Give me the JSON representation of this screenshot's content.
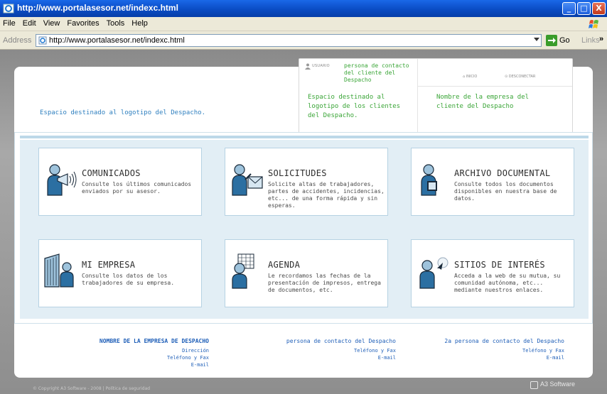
{
  "window": {
    "title": "http://www.portalasesor.net/indexc.html",
    "btn_min": "_",
    "btn_max": "□",
    "btn_close": "X"
  },
  "menu": [
    "File",
    "Edit",
    "View",
    "Favorites",
    "Tools",
    "Help"
  ],
  "address": {
    "label": "Address",
    "url": "http://www.portalasesor.net/indexc.html",
    "go": "Go",
    "links": "Links",
    "chevrons": "»"
  },
  "header": {
    "logo_text": "Espacio destinado al logotipo del Despacho.",
    "usuario_label": "USUARIO",
    "contact_person": "persona de contacto del cliente del Despacho",
    "inicio": "INICIO",
    "desconectar": "DESCONECTAR",
    "client_logo_text": "Espacio destinado al logotipo de los clientes del Despacho.",
    "client_company_text": "Nombre de la empresa del cliente del Despacho"
  },
  "sections": [
    {
      "title": "COMUNICADOS",
      "desc": "Consulte los últimos comunicados enviados por su asesor.",
      "icon": "megaphone-person-icon"
    },
    {
      "title": "SOLICITUDES",
      "desc": "Solicite altas de trabajadores, partes de accidentes, incidencias, etc... de una forma rápida y sin esperas.",
      "icon": "request-person-icon"
    },
    {
      "title": "ARCHIVO DOCUMENTAL",
      "desc": "Consulte todos los documentos disponibles en nuestra base de datos.",
      "icon": "documents-person-icon"
    },
    {
      "title": "MI EMPRESA",
      "desc": "Consulte los datos de los trabajadores de su empresa.",
      "icon": "building-person-icon"
    },
    {
      "title": "AGENDA",
      "desc": "Le recordamos las fechas de la presentación de impresos, entrega de documentos, etc.",
      "icon": "calendar-person-icon"
    },
    {
      "title": "SITIOS DE INTERÉS",
      "desc": "Acceda a la web de su mutua, su comunidad autónoma, etc... mediante nuestros enlaces.",
      "icon": "cursor-person-icon"
    }
  ],
  "footer": {
    "col1": {
      "head": "NOMBRE DE LA EMPRESA DE DESPACHO",
      "l1": "Dirección",
      "l2": "Teléfono y Fax",
      "l3": "E-mail"
    },
    "col2": {
      "head": "persona de contacto del Despacho",
      "l1": "Teléfono y Fax",
      "l2": "E-mail"
    },
    "col3": {
      "head": "2a persona de contacto del Despacho",
      "l1": "Teléfono y Fax",
      "l2": "E-mail"
    }
  },
  "copyright": "© Copyright A3 Software - 2008 | Política de seguridad",
  "brand": "A3 Software",
  "colors": {
    "title_blue": "#0a4cc4",
    "link_blue": "#2e7fbf",
    "green": "#3aa537",
    "footer_blue": "#1f5fb8"
  }
}
